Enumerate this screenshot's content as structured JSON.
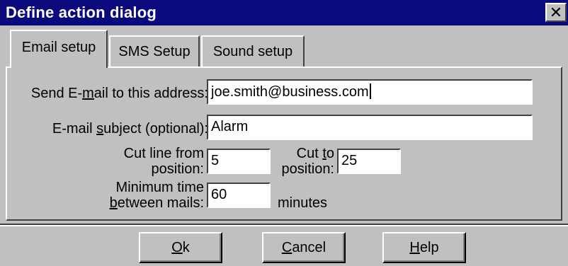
{
  "window": {
    "title": "Define action dialog",
    "close_glyph": "✕"
  },
  "tabs": [
    {
      "label": "Email setup",
      "active": true
    },
    {
      "label": "SMS Setup",
      "active": false
    },
    {
      "label": "Sound setup",
      "active": false
    }
  ],
  "form": {
    "email_address": {
      "label_pre": "Send E-",
      "label_mn": "m",
      "label_post": "ail to this address:",
      "value": "joe.smith@business.com"
    },
    "subject": {
      "label_pre": "E-mail ",
      "label_mn": "s",
      "label_post": "ubject (optional):",
      "value": "Alarm"
    },
    "cut_from": {
      "label_line1": "Cut line from",
      "label_line2": "position:",
      "value": "5"
    },
    "cut_to": {
      "label_line1_pre": "Cut ",
      "label_line1_mn": "t",
      "label_line1_post": "o",
      "label_line2": "position:",
      "value": "25"
    },
    "min_time": {
      "label_line1": "Minimum time",
      "label_line2_mn": "b",
      "label_line2_post": "etween mails:",
      "value": "60",
      "unit": "minutes"
    }
  },
  "buttons": {
    "ok": {
      "mn": "O",
      "rest": "k"
    },
    "cancel": {
      "mn": "C",
      "rest": "ancel"
    },
    "help": {
      "mn": "H",
      "rest": "elp"
    }
  },
  "colors": {
    "title_bar": "#0a0a7c",
    "face": "#c0c0c0",
    "field_bg": "#ffffff"
  }
}
